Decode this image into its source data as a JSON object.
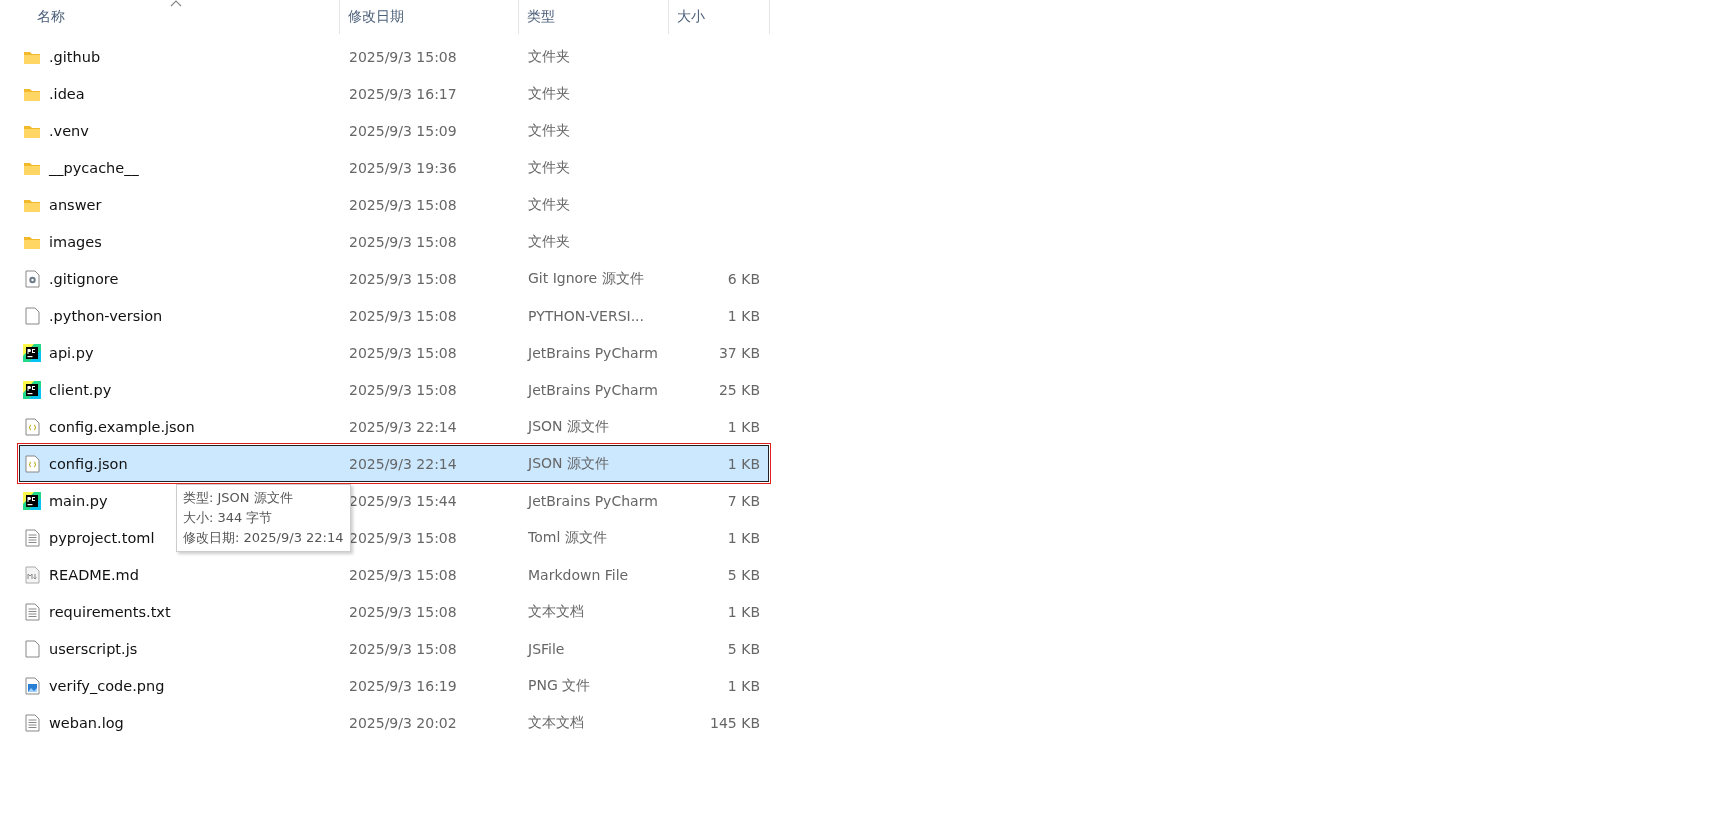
{
  "columns": [
    {
      "label": "名称",
      "sorted": true
    },
    {
      "label": "修改日期",
      "sorted": false
    },
    {
      "label": "类型",
      "sorted": false
    },
    {
      "label": "大小",
      "sorted": false
    }
  ],
  "rows": [
    {
      "kind": "folder",
      "name": ".github",
      "modified": "2025/9/3 15:08",
      "type": "文件夹",
      "selected": false,
      "marked": false
    },
    {
      "kind": "folder",
      "name": ".idea",
      "modified": "2025/9/3 16:17",
      "type": "文件夹",
      "selected": false,
      "marked": false
    },
    {
      "kind": "folder",
      "name": ".venv",
      "modified": "2025/9/3 15:09",
      "type": "文件夹",
      "selected": false,
      "marked": false
    },
    {
      "kind": "folder",
      "name": "__pycache__",
      "modified": "2025/9/3 19:36",
      "type": "文件夹",
      "selected": false,
      "marked": false
    },
    {
      "kind": "folder",
      "name": "answer",
      "modified": "2025/9/3 15:08",
      "type": "文件夹",
      "selected": false,
      "marked": false
    },
    {
      "kind": "folder",
      "name": "images",
      "modified": "2025/9/3 15:08",
      "type": "文件夹",
      "selected": false,
      "marked": false
    },
    {
      "kind": "settings",
      "name": ".gitignore",
      "modified": "2025/9/3 15:08",
      "type": "Git Ignore 源文件",
      "size": "6 KB",
      "selected": false,
      "marked": false
    },
    {
      "kind": "blank",
      "name": ".python-version",
      "modified": "2025/9/3 15:08",
      "type": "PYTHON-VERSI...",
      "size": "1 KB",
      "selected": false,
      "marked": false
    },
    {
      "kind": "pycharm",
      "name": "api.py",
      "modified": "2025/9/3 15:08",
      "type": "JetBrains PyCharm",
      "size": "37 KB",
      "selected": false,
      "marked": false
    },
    {
      "kind": "pycharm",
      "name": "client.py",
      "modified": "2025/9/3 15:08",
      "type": "JetBrains PyCharm",
      "size": "25 KB",
      "selected": false,
      "marked": false
    },
    {
      "kind": "json",
      "name": "config.example.json",
      "modified": "2025/9/3 22:14",
      "type": "JSON 源文件",
      "size": "1 KB",
      "selected": false,
      "marked": false
    },
    {
      "kind": "json",
      "name": "config.json",
      "modified": "2025/9/3 22:14",
      "type": "JSON 源文件",
      "size": "1 KB",
      "selected": true,
      "marked": true
    },
    {
      "kind": "pycharm",
      "name": "main.py",
      "modified": "2025/9/3 15:44",
      "type": "JetBrains PyCharm",
      "size": "7 KB",
      "selected": false,
      "marked": false
    },
    {
      "kind": "text",
      "name": "pyproject.toml",
      "modified": "2025/9/3 15:08",
      "type": "Toml 源文件",
      "size": "1 KB",
      "selected": false,
      "marked": false
    },
    {
      "kind": "markdown",
      "name": "README.md",
      "modified": "2025/9/3 15:08",
      "type": "Markdown File",
      "size": "5 KB",
      "selected": false,
      "marked": false
    },
    {
      "kind": "text",
      "name": "requirements.txt",
      "modified": "2025/9/3 15:08",
      "type": "文本文档",
      "size": "1 KB",
      "selected": false,
      "marked": false
    },
    {
      "kind": "blank",
      "name": "userscript.js",
      "modified": "2025/9/3 15:08",
      "type": "JSFile",
      "size": "5 KB",
      "selected": false,
      "marked": false
    },
    {
      "kind": "image",
      "name": "verify_code.png",
      "modified": "2025/9/3 16:19",
      "type": "PNG 文件",
      "size": "1 KB",
      "selected": false,
      "marked": false
    },
    {
      "kind": "text",
      "name": "weban.log",
      "modified": "2025/9/3 20:02",
      "type": "文本文档",
      "size": "145 KB",
      "selected": false,
      "marked": false
    }
  ],
  "tooltip": {
    "lines": [
      "类型: JSON 源文件",
      "大小: 344 字节",
      "修改日期: 2025/9/3 22:14"
    ]
  }
}
